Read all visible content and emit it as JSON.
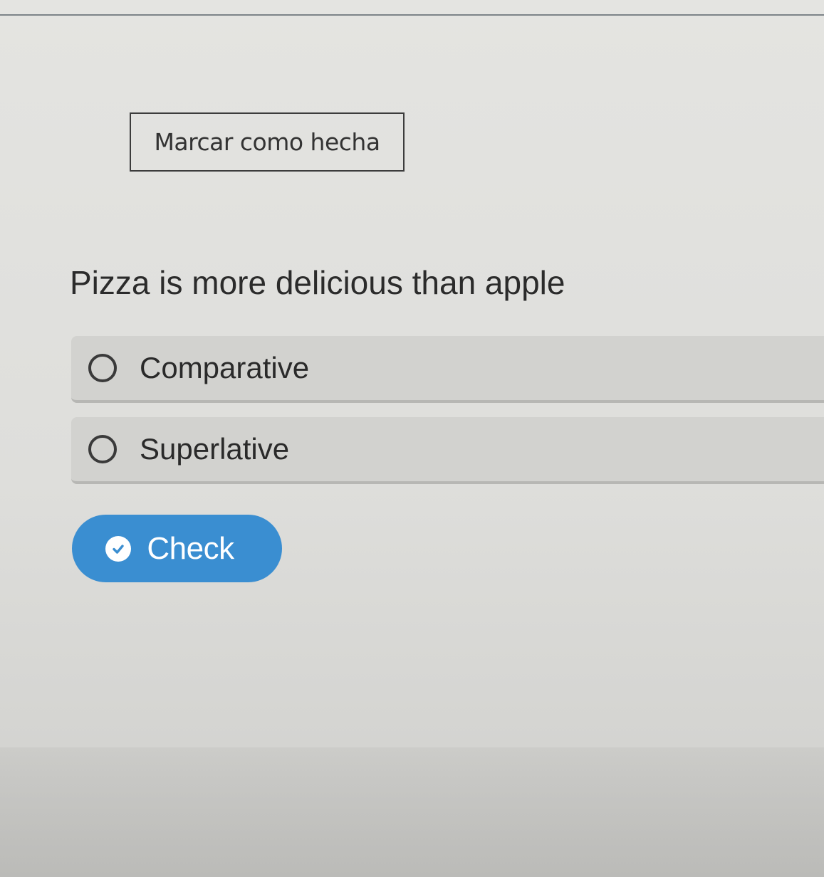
{
  "header": {
    "mark_done_label": "Marcar como hecha"
  },
  "question": {
    "text": "Pizza is more delicious than apple"
  },
  "options": [
    {
      "label": "Comparative",
      "selected": false
    },
    {
      "label": "Superlative",
      "selected": false
    }
  ],
  "actions": {
    "check_label": "Check",
    "check_icon": "check-circle-icon"
  },
  "colors": {
    "check_button": "#3a8ed1",
    "option_background": "#d2d2cf"
  }
}
